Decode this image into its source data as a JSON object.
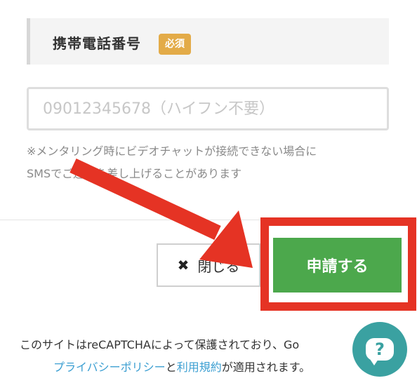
{
  "form": {
    "field_label": "携帯電話番号",
    "required_badge": "必須",
    "phone_placeholder": "09012345678（ハイフン不要）",
    "phone_value": "",
    "note_line1": "※メンタリング時にビデオチャットが接続できない場合に",
    "note_line2": "SMSでご連絡を差し上げることがあります"
  },
  "actions": {
    "close_label": "閉じる",
    "close_icon": "✖",
    "submit_label": "申請する"
  },
  "footer": {
    "recaptcha_text": "このサイトはreCAPTCHAによって保護されており、Go",
    "privacy_link": "プライバシーポリシー",
    "and_text": "と",
    "terms_link": "利用規約",
    "applies_text": "が適用されます。"
  },
  "help": {
    "icon": "help-chat-icon",
    "glyph": "?"
  },
  "colors": {
    "accent_green": "#4ca84c",
    "highlight_red": "#e53324",
    "badge_orange": "#e3ab48",
    "link_blue": "#3c9fd2",
    "help_teal": "#3aa1a1"
  }
}
